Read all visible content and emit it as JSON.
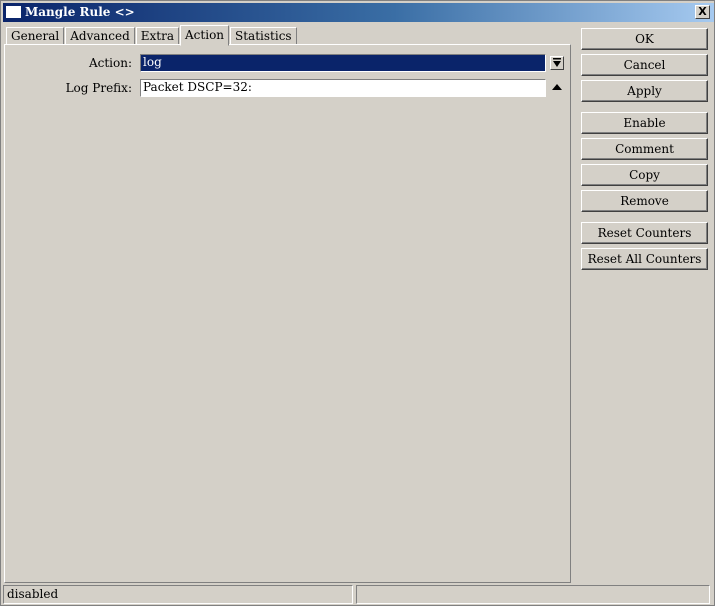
{
  "window": {
    "title": "Mangle Rule <>",
    "close_label": "X"
  },
  "tabs": [
    {
      "label": "General"
    },
    {
      "label": "Advanced"
    },
    {
      "label": "Extra"
    },
    {
      "label": "Action",
      "active": true
    },
    {
      "label": "Statistics"
    }
  ],
  "form": {
    "action_label": "Action:",
    "action_value": "log",
    "log_prefix_label": "Log Prefix:",
    "log_prefix_value": "Packet DSCP=32:"
  },
  "buttons": {
    "ok": "OK",
    "cancel": "Cancel",
    "apply": "Apply",
    "enable": "Enable",
    "comment": "Comment",
    "copy": "Copy",
    "remove": "Remove",
    "reset_counters": "Reset Counters",
    "reset_all_counters": "Reset All Counters"
  },
  "status": {
    "state": "disabled",
    "secondary": ""
  },
  "icons": {
    "dropdown": "dropdown-arrow-icon",
    "collapse": "triangle-up-icon",
    "window": "window-icon"
  },
  "colors": {
    "title_start": "#0a246a",
    "title_end": "#a6caf0",
    "selection": "#0a246a",
    "face": "#d4d0c8"
  }
}
